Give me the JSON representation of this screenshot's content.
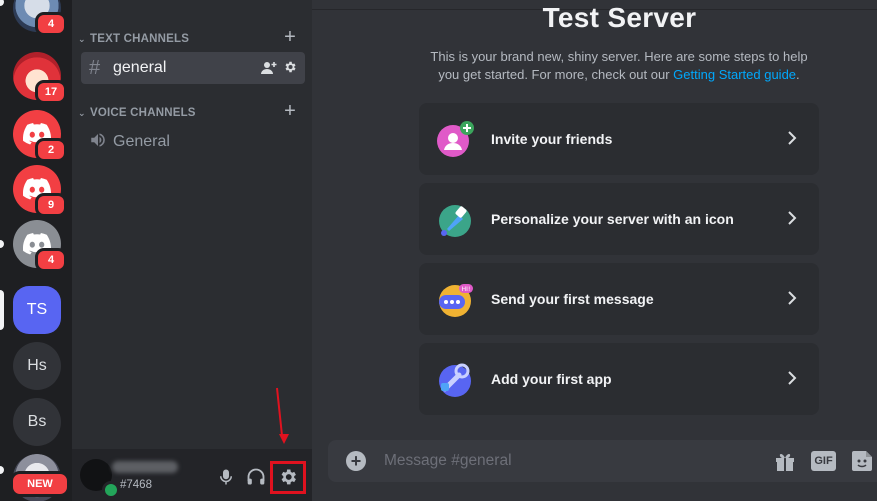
{
  "servers": [
    {
      "name": "server-1",
      "badge": "4"
    },
    {
      "name": "server-2",
      "badge": "17"
    },
    {
      "name": "server-3",
      "badge": "2"
    },
    {
      "name": "server-4",
      "badge": "9"
    },
    {
      "name": "server-5",
      "badge": "4"
    },
    {
      "name": "server-ts",
      "label": "TS"
    },
    {
      "name": "server-hs",
      "label": "Hs"
    },
    {
      "name": "server-bs",
      "label": "Bs"
    },
    {
      "name": "server-new",
      "badge": "NEW"
    }
  ],
  "sidebar": {
    "text_category": "TEXT CHANNELS",
    "text_channel": "general",
    "voice_category": "VOICE CHANNELS",
    "voice_channel": "General"
  },
  "user": {
    "tag": "#7468"
  },
  "main": {
    "title": "Test Server",
    "subtitle_text": "This is your brand new, shiny server. Here are some steps to help you get started. For more, check out our ",
    "subtitle_link": "Getting Started guide",
    "subtitle_end": ".",
    "cards": [
      {
        "label": "Invite your friends",
        "icon": "invite-friends-icon"
      },
      {
        "label": "Personalize your server with an icon",
        "icon": "personalize-icon"
      },
      {
        "label": "Send your first message",
        "icon": "message-icon"
      },
      {
        "label": "Add your first app",
        "icon": "app-icon"
      }
    ]
  },
  "composer": {
    "placeholder": "Message #general",
    "gif_label": "GIF"
  },
  "colors": {
    "accent": "#5865f2",
    "badge_red": "#f23f43",
    "online": "#23a55a",
    "link": "#00a8fc",
    "highlight": "#e0121f"
  }
}
